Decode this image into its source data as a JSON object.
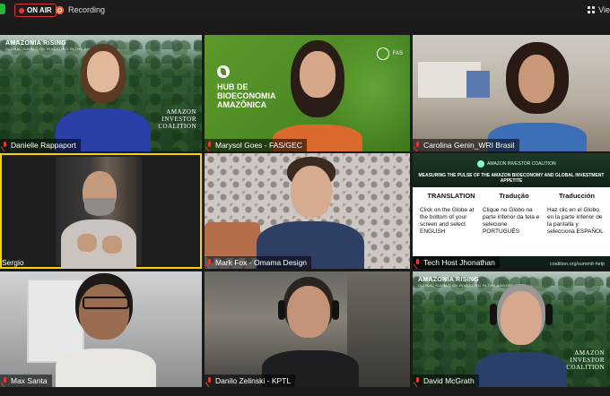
{
  "topbar": {
    "on_air_label": "ON AIR",
    "recording_label": "Recording",
    "view_label": "Vie"
  },
  "tiles": [
    {
      "name": "Danielle Rappaport"
    },
    {
      "name": "Marysol Goes - FAS/GEC"
    },
    {
      "name": "Carolina Genin_WRI Brasil"
    },
    {
      "name": "Sergio"
    },
    {
      "name": "Mark Fox - Omama Design"
    },
    {
      "name": "Tech Host Jhonathan"
    },
    {
      "name": "Max Santa"
    },
    {
      "name": "Danilo Zelinski - KPTL"
    },
    {
      "name": "David McGrath"
    }
  ],
  "backgrounds": {
    "amazonia_rising": "AMAZONIA RISING",
    "amazonia_sub": "GLOBAL SUMMIT ON INVESTING IN THE AMAZON",
    "coalition_1": "AMAZON",
    "coalition_2": "INVESTOR",
    "coalition_3": "COALITION",
    "hub_1": "HUB DE",
    "hub_2": "BIOECONOMIA",
    "hub_3": "AMAZÔNICA",
    "fas": "FAS"
  },
  "slide": {
    "logo": "AMAZON INVESTOR COALITION",
    "title": "MEASURING THE PULSE OF THE AMAZON BIOECONOMY AND GLOBAL INVESTMENT APPETITE",
    "col1_head": "TRANSLATION",
    "col1_text": "Click on the Globe at the bottom of your screen and select ENGLISH",
    "col2_head": "Tradução",
    "col2_text": "Clique no Globo na parte inferior da tela e selecione PORTUGUÊS",
    "col3_head": "Traducción",
    "col3_text": "Haz clic en el Globo en la parte inferior de la pantalla y selecciona ESPAÑOL",
    "url": "coalition.org/summit-help"
  },
  "colors": {
    "on_air": "#dd3333",
    "recording": "#f05a28",
    "active_speaker": "#f5d400",
    "muted_mic": "#ee3333"
  }
}
